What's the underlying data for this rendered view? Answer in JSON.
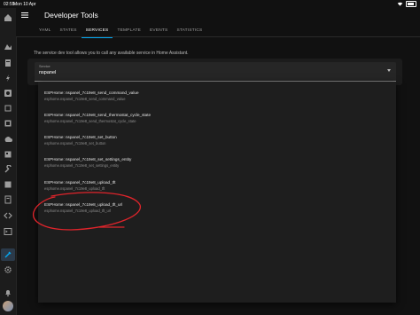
{
  "status_bar": {
    "time": "02:55",
    "date": "Mon 10 Apr",
    "battery_icon": "battery-icon",
    "wifi_icon": "wifi-icon"
  },
  "header": {
    "title": "Developer Tools",
    "tabs": [
      {
        "label": "YAML"
      },
      {
        "label": "STATES"
      },
      {
        "label": "SERVICES"
      },
      {
        "label": "TEMPLATE"
      },
      {
        "label": "EVENTS"
      },
      {
        "label": "STATISTICS"
      }
    ],
    "active_tab": "SERVICES"
  },
  "main": {
    "description": "The service dev tool allows you to call any available service in Home Assistant.",
    "service_field": {
      "label": "Service",
      "value": "nspanel"
    }
  },
  "dropdown": {
    "options": [
      {
        "title": "ESPHome: nspanel_7c19e8_send_command_value",
        "subtitle": "esphome.nspanel_7c19e8_send_command_value"
      },
      {
        "title": "ESPHome: nspanel_7c19e8_send_thermostat_cycle_state",
        "subtitle": "esphome.nspanel_7c19e8_send_thermostat_cycle_state"
      },
      {
        "title": "ESPHome: nspanel_7c19e8_set_button",
        "subtitle": "esphome.nspanel_7c19e8_set_button"
      },
      {
        "title": "ESPHome: nspanel_7c19e8_set_settings_entity",
        "subtitle": "esphome.nspanel_7c19e8_set_settings_entity"
      },
      {
        "title": "ESPHome: nspanel_7c19e8_upload_tft",
        "subtitle": "esphome.nspanel_7c19e8_upload_tft"
      },
      {
        "title": "ESPHome: nspanel_7c19e8_upload_tft_url",
        "subtitle": "esphome.nspanel_7c19e8_upload_tft_url"
      }
    ]
  },
  "sidebar": {
    "icons": [
      "overview-icon",
      "map-icon",
      "logbook-icon",
      "history-icon",
      "media-icon",
      "todo-icon",
      "energy-icon",
      "calendar-icon",
      "hacs-icon",
      "tools-icon",
      "terminal-icon",
      "studio-code-icon",
      "code-icon",
      "console-icon",
      "developer-tools-icon",
      "settings-icon",
      "notifications-icon"
    ]
  },
  "colors": {
    "accent": "#03a9f4",
    "annotation": "#e0242b",
    "background": "#111111"
  }
}
